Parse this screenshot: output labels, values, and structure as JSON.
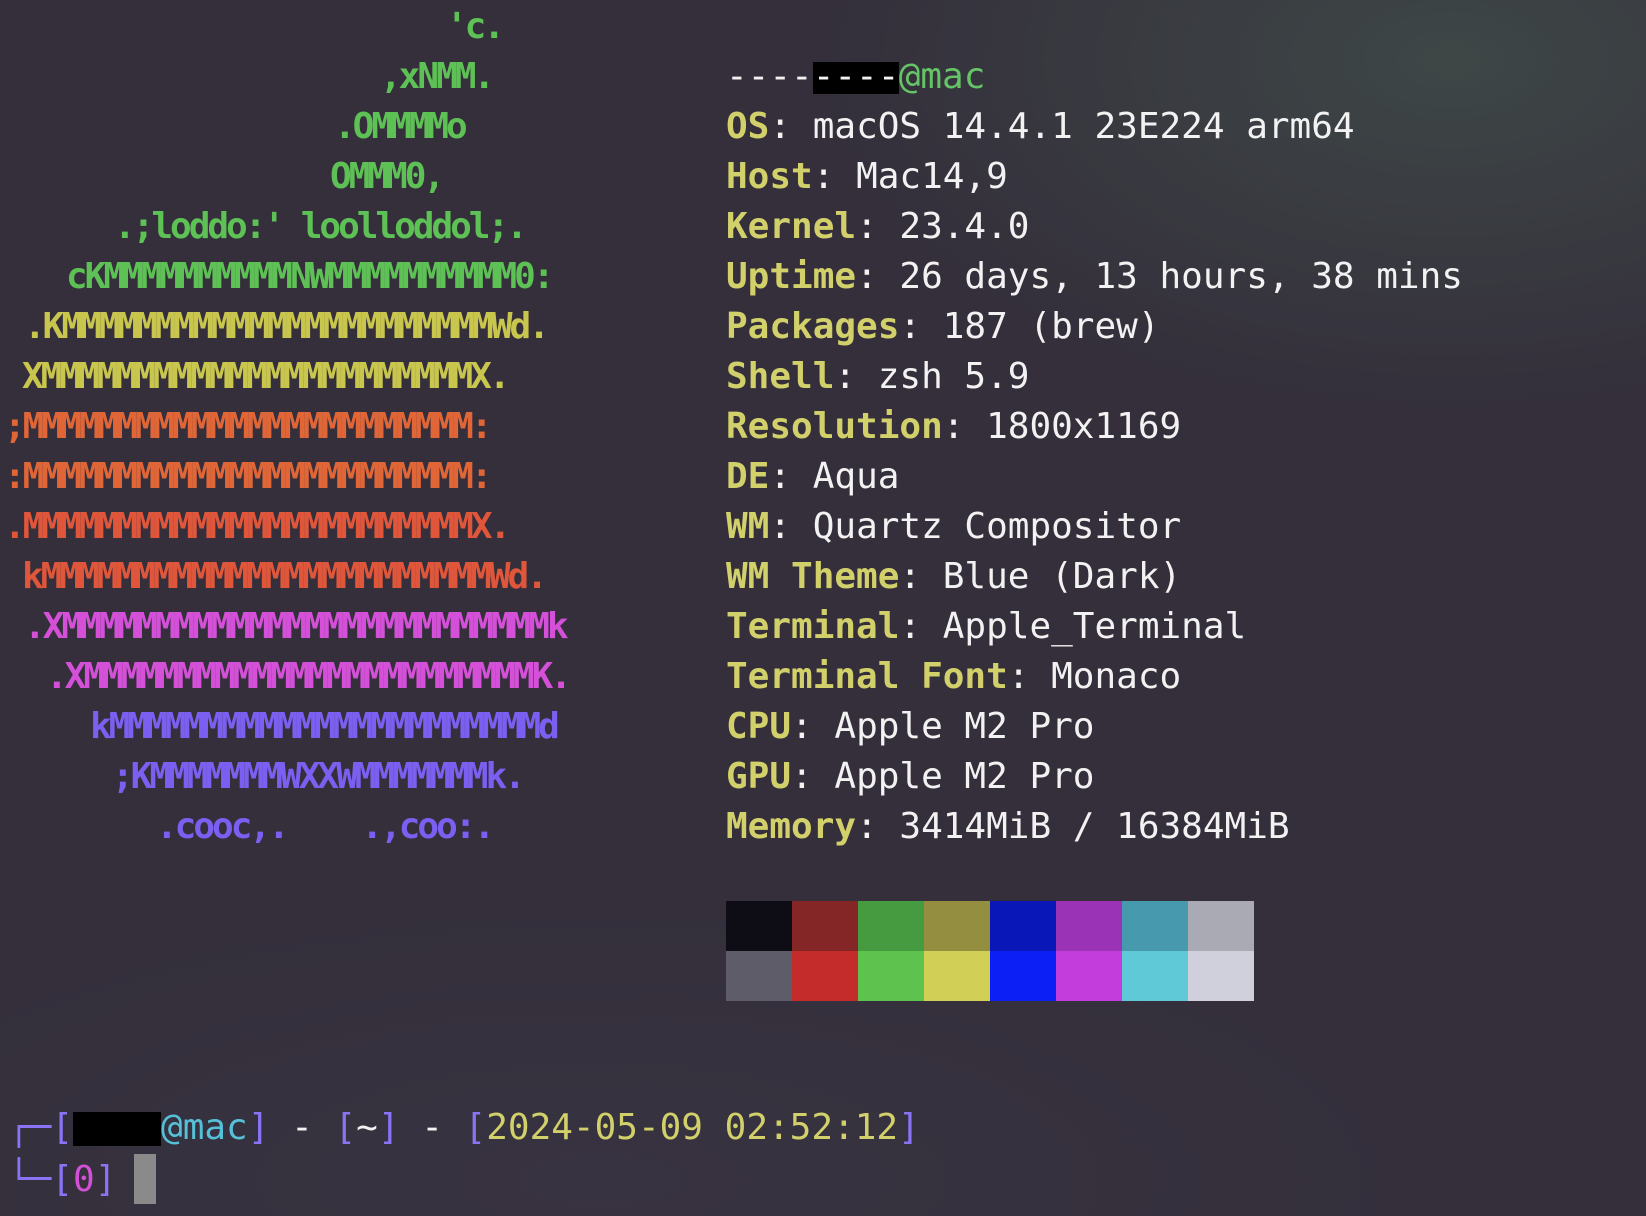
{
  "logo": {
    "lines": [
      {
        "text": "'c.",
        "color": "#5ec155"
      },
      {
        "text": ",xNMM.",
        "color": "#5ec155"
      },
      {
        "text": ".OMMMMo",
        "color": "#5ec155"
      },
      {
        "text": "OMMM0,",
        "color": "#5ec155"
      },
      {
        "text": ".;loddo:' loolloddol;.",
        "color": "#5ec155"
      },
      {
        "text": "cKMMMMMMMMMMNWMMMMMMMMMM0:",
        "color": "#5ec155"
      },
      {
        "text": ".KMMMMMMMMMMMMMMMMMMMMMMMWd.",
        "color": "#c9c64e"
      },
      {
        "text": "XMMMMMMMMMMMMMMMMMMMMMMMX.",
        "color": "#c9c64e"
      },
      {
        "text": ";MMMMMMMMMMMMMMMMMMMMMMMM:",
        "color": "#e06638"
      },
      {
        "text": ":MMMMMMMMMMMMMMMMMMMMMMMM:",
        "color": "#e06638"
      },
      {
        "text": ".MMMMMMMMMMMMMMMMMMMMMMMMX.",
        "color": "#e0563a"
      },
      {
        "text": "kMMMMMMMMMMMMMMMMMMMMMMMMWd.",
        "color": "#e0563a"
      },
      {
        "text": ".XMMMMMMMMMMMMMMMMMMMMMMMMMMk",
        "color": "#d450d8"
      },
      {
        "text": ".XMMMMMMMMMMMMMMMMMMMMMMMMK.",
        "color": "#d450d8"
      },
      {
        "text": "kMMMMMMMMMMMMMMMMMMMMMMMd",
        "color": "#7a5ff0"
      },
      {
        "text": ";KMMMMMMMWXXWMMMMMMMk.",
        "color": "#7a5ff0"
      },
      {
        "text": ".cooc,.    .,coo:.",
        "color": "#7a5ff0"
      }
    ]
  },
  "info": {
    "header_host": "@mac",
    "separator": "--------",
    "rows": [
      {
        "key": "OS",
        "value": "macOS 14.4.1 23E224 arm64"
      },
      {
        "key": "Host",
        "value": "Mac14,9"
      },
      {
        "key": "Kernel",
        "value": "23.4.0"
      },
      {
        "key": "Uptime",
        "value": "26 days, 13 hours, 38 mins"
      },
      {
        "key": "Packages",
        "value": "187 (brew)"
      },
      {
        "key": "Shell",
        "value": "zsh 5.9"
      },
      {
        "key": "Resolution",
        "value": "1800x1169"
      },
      {
        "key": "DE",
        "value": "Aqua"
      },
      {
        "key": "WM",
        "value": "Quartz Compositor"
      },
      {
        "key": "WM Theme",
        "value": "Blue (Dark)"
      },
      {
        "key": "Terminal",
        "value": "Apple_Terminal"
      },
      {
        "key": "Terminal Font",
        "value": "Monaco"
      },
      {
        "key": "CPU",
        "value": "Apple M2 Pro"
      },
      {
        "key": "GPU",
        "value": "Apple M2 Pro"
      },
      {
        "key": "Memory",
        "value": "3414MiB / 16384MiB"
      }
    ]
  },
  "palette": {
    "normal": [
      "#0e0c14",
      "#842626",
      "#469a40",
      "#938e40",
      "#0a17b8",
      "#9a33b6",
      "#479aae",
      "#a9aab3"
    ],
    "bright": [
      "#5e5c68",
      "#c42b2b",
      "#5ec24e",
      "#d2cf56",
      "#0c1ff4",
      "#c23ddc",
      "#60c9d8",
      "#d0d0dc"
    ]
  },
  "prompt": {
    "line1_open": "┌─[",
    "line1_host": "@mac",
    "line1_close": "]",
    "sep1": " - ",
    "dir_open": "[",
    "dir": "~",
    "dir_close": "]",
    "sep2": " - ",
    "time_open": "[",
    "time": "2024-05-09 02:52:12",
    "time_close": "]",
    "line2_open": "└─[",
    "exit_code": "0",
    "line2_close": "]"
  }
}
